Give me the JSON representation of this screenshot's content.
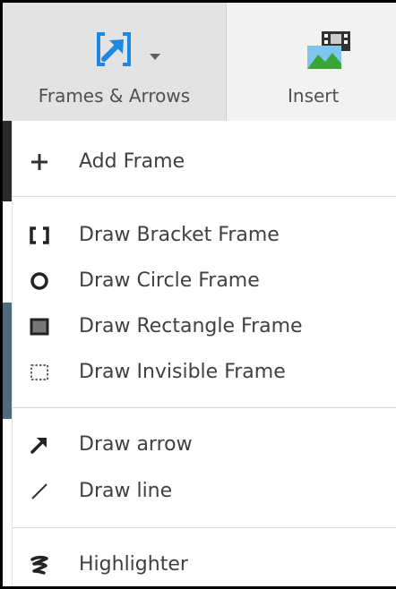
{
  "toolbar": {
    "frames_label": "Frames & Arrows",
    "frames_icon": "frames-arrows-icon",
    "insert_label": "Insert",
    "insert_icon": "insert-image-icon"
  },
  "menu": {
    "add_frame": "Add Frame",
    "bracket_frame": "Draw Bracket Frame",
    "circle_frame": "Draw Circle Frame",
    "rectangle_frame": "Draw Rectangle Frame",
    "invisible_frame": "Draw Invisible Frame",
    "arrow": "Draw arrow",
    "line": "Draw line",
    "highlighter": "Highlighter"
  },
  "colors": {
    "accent_blue": "#1e88e5",
    "text": "#404040",
    "toolbar_bg": "#f2f2f2"
  }
}
